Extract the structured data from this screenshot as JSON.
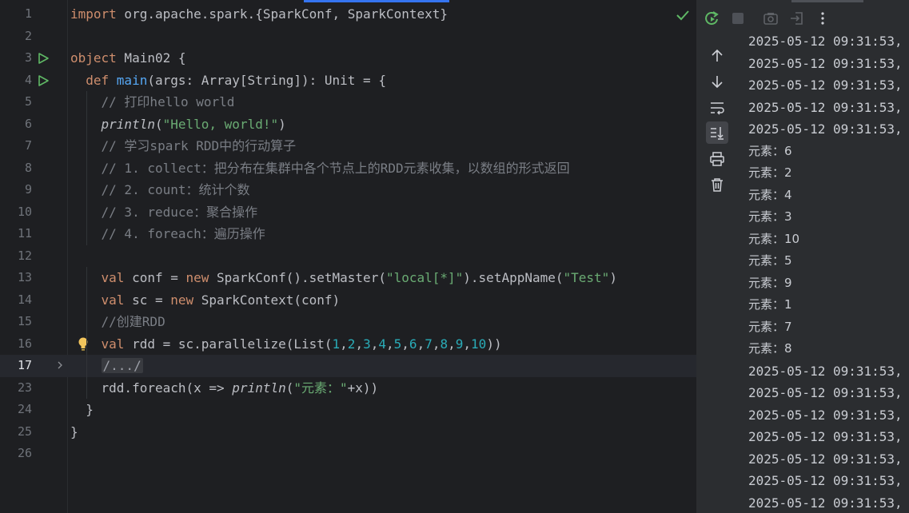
{
  "editor": {
    "lines": [
      {
        "n": "1",
        "segs": [
          {
            "t": "import",
            "c": "kw"
          },
          {
            "t": " org.apache.spark.{SparkConf, SparkContext}",
            "c": "ident"
          }
        ]
      },
      {
        "n": "2",
        "segs": []
      },
      {
        "n": "3",
        "run": true,
        "segs": [
          {
            "t": "object",
            "c": "kw"
          },
          {
            "t": " Main02 {",
            "c": "ident"
          }
        ]
      },
      {
        "n": "4",
        "run": true,
        "segs": [
          {
            "t": "  def ",
            "c": "kw"
          },
          {
            "t": "main",
            "c": "fn"
          },
          {
            "t": "(args: Array[String]): Unit = {",
            "c": "ident"
          }
        ]
      },
      {
        "n": "5",
        "segs": [
          {
            "t": "    // 打印hello world",
            "c": "cm"
          }
        ]
      },
      {
        "n": "6",
        "segs": [
          {
            "t": "    ",
            "c": "ident"
          },
          {
            "t": "println",
            "c": "ident it"
          },
          {
            "t": "(",
            "c": "ident"
          },
          {
            "t": "\"Hello, world!\"",
            "c": "str"
          },
          {
            "t": ")",
            "c": "ident"
          }
        ]
      },
      {
        "n": "7",
        "segs": [
          {
            "t": "    // 学习spark RDD中的行动算子",
            "c": "cm"
          }
        ]
      },
      {
        "n": "8",
        "segs": [
          {
            "t": "    // 1. collect：把分布在集群中各个节点上的RDD元素收集，以数组的形式返回",
            "c": "cm"
          }
        ]
      },
      {
        "n": "9",
        "segs": [
          {
            "t": "    // 2. count：统计个数",
            "c": "cm"
          }
        ]
      },
      {
        "n": "10",
        "segs": [
          {
            "t": "    // 3. reduce：聚合操作",
            "c": "cm"
          }
        ]
      },
      {
        "n": "11",
        "segs": [
          {
            "t": "    // 4. foreach：遍历操作",
            "c": "cm"
          }
        ]
      },
      {
        "n": "12",
        "segs": []
      },
      {
        "n": "13",
        "segs": [
          {
            "t": "    val ",
            "c": "kw"
          },
          {
            "t": "conf = ",
            "c": "ident"
          },
          {
            "t": "new ",
            "c": "kw"
          },
          {
            "t": "SparkConf().setMaster(",
            "c": "ident"
          },
          {
            "t": "\"local[*]\"",
            "c": "str"
          },
          {
            "t": ").setAppName(",
            "c": "ident"
          },
          {
            "t": "\"Test\"",
            "c": "str"
          },
          {
            "t": ")",
            "c": "ident"
          }
        ]
      },
      {
        "n": "14",
        "segs": [
          {
            "t": "    val ",
            "c": "kw"
          },
          {
            "t": "sc = ",
            "c": "ident"
          },
          {
            "t": "new ",
            "c": "kw"
          },
          {
            "t": "SparkContext(conf)",
            "c": "ident"
          }
        ]
      },
      {
        "n": "15",
        "segs": [
          {
            "t": "    //创建RDD",
            "c": "cm"
          }
        ]
      },
      {
        "n": "16",
        "bulb": true,
        "segs": [
          {
            "t": "    val ",
            "c": "kw"
          },
          {
            "t": "rdd = sc.parallelize(List(",
            "c": "ident"
          },
          {
            "t": "1",
            "c": "num"
          },
          {
            "t": ",",
            "c": "ident"
          },
          {
            "t": "2",
            "c": "num"
          },
          {
            "t": ",",
            "c": "ident"
          },
          {
            "t": "3",
            "c": "num"
          },
          {
            "t": ",",
            "c": "ident"
          },
          {
            "t": "4",
            "c": "num"
          },
          {
            "t": ",",
            "c": "ident"
          },
          {
            "t": "5",
            "c": "num"
          },
          {
            "t": ",",
            "c": "ident"
          },
          {
            "t": "6",
            "c": "num"
          },
          {
            "t": ",",
            "c": "ident"
          },
          {
            "t": "7",
            "c": "num"
          },
          {
            "t": ",",
            "c": "ident"
          },
          {
            "t": "8",
            "c": "num"
          },
          {
            "t": ",",
            "c": "ident"
          },
          {
            "t": "9",
            "c": "num"
          },
          {
            "t": ",",
            "c": "ident"
          },
          {
            "t": "10",
            "c": "num"
          },
          {
            "t": "))",
            "c": "ident"
          }
        ]
      },
      {
        "n": "17",
        "current": true,
        "fold": true,
        "segs": [
          {
            "t": "    ",
            "c": "ident"
          },
          {
            "t": "/.../",
            "c": "fold-box"
          }
        ]
      },
      {
        "n": "23",
        "segs": [
          {
            "t": "    rdd.foreach(x => ",
            "c": "ident"
          },
          {
            "t": "println",
            "c": "ident it"
          },
          {
            "t": "(",
            "c": "ident"
          },
          {
            "t": "\"元素：\"",
            "c": "str"
          },
          {
            "t": "+x))",
            "c": "ident"
          }
        ]
      },
      {
        "n": "24",
        "segs": [
          {
            "t": "  }",
            "c": "ident"
          }
        ]
      },
      {
        "n": "25",
        "segs": [
          {
            "t": "}",
            "c": "ident"
          }
        ]
      },
      {
        "n": "26",
        "segs": []
      }
    ]
  },
  "console": {
    "lines": [
      "2025-05-12 09:31:53,",
      "2025-05-12 09:31:53,",
      "2025-05-12 09:31:53,",
      "2025-05-12 09:31:53,",
      "2025-05-12 09:31:53,",
      "元素：6",
      "元素：2",
      "元素：4",
      "元素：3",
      "元素：10",
      "元素：5",
      "元素：9",
      "元素：1",
      "元素：7",
      "元素：8",
      "2025-05-12 09:31:53,",
      "2025-05-12 09:31:53,",
      "2025-05-12 09:31:53,",
      "2025-05-12 09:31:53,",
      "2025-05-12 09:31:53,",
      "2025-05-12 09:31:53,",
      "2025-05-12 09:31:53,"
    ]
  },
  "colors": {
    "editor_bg": "#1e1f22",
    "toolwindow_bg": "#2b2d30",
    "keyword": "#cf8e6d",
    "function": "#56a8f5",
    "string": "#6aab73",
    "number": "#2aacb8",
    "comment": "#7a7e85",
    "run_icon": "#5fb865",
    "accent": "#3574f0"
  }
}
